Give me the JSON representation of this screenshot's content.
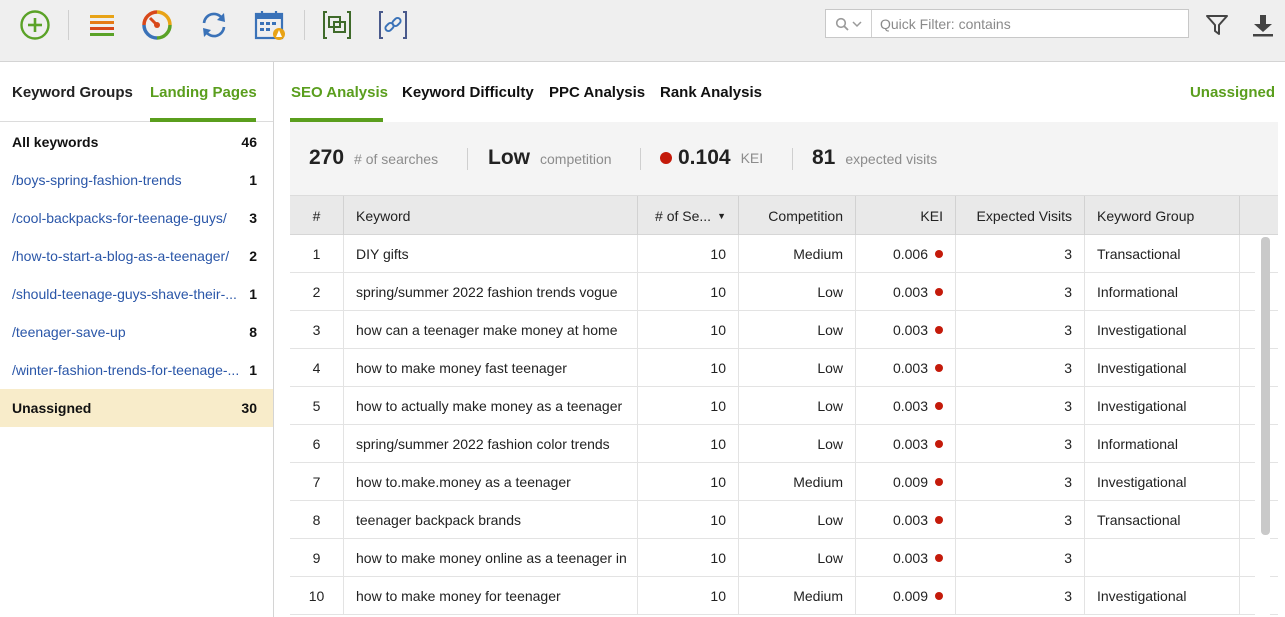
{
  "toolbar": {
    "buttons": [
      {
        "name": "add-icon"
      },
      {
        "name": "list-icon"
      },
      {
        "name": "gauge-icon"
      },
      {
        "name": "refresh-icon"
      },
      {
        "name": "calendar-schedule-icon"
      },
      {
        "name": "copy-icon"
      },
      {
        "name": "link-icon"
      }
    ],
    "quick_filter": {
      "placeholder": "Quick Filter: contains",
      "value": ""
    },
    "accent_color": "#5a9e1d"
  },
  "left_panel": {
    "tabs": [
      {
        "label": "Keyword Groups",
        "active": false
      },
      {
        "label": "Landing Pages",
        "active": true
      }
    ],
    "items": [
      {
        "label": "All keywords",
        "count": "46",
        "bold": true,
        "selected": false
      },
      {
        "label": "/boys-spring-fashion-trends",
        "count": "1",
        "bold": false,
        "selected": false
      },
      {
        "label": "/cool-backpacks-for-teenage-guys/",
        "count": "3",
        "bold": false,
        "selected": false
      },
      {
        "label": "/how-to-start-a-blog-as-a-teenager/",
        "count": "2",
        "bold": false,
        "selected": false
      },
      {
        "label": "/should-teenage-guys-shave-their-...",
        "count": "1",
        "bold": false,
        "selected": false
      },
      {
        "label": "/teenager-save-up",
        "count": "8",
        "bold": false,
        "selected": false
      },
      {
        "label": "/winter-fashion-trends-for-teenage-...",
        "count": "1",
        "bold": false,
        "selected": false
      },
      {
        "label": "Unassigned",
        "count": "30",
        "bold": true,
        "selected": true
      }
    ]
  },
  "main": {
    "tabs": [
      {
        "label": "SEO Analysis",
        "active": true
      },
      {
        "label": "Keyword Difficulty",
        "active": false
      },
      {
        "label": "PPC Analysis",
        "active": false
      },
      {
        "label": "Rank Analysis",
        "active": false
      }
    ],
    "current_group": "Unassigned",
    "summary": {
      "searches": {
        "value": "270",
        "label": "# of searches"
      },
      "competition": {
        "value": "Low",
        "label": "competition"
      },
      "kei": {
        "value": "0.104",
        "label": "KEI",
        "dot_color": "#c41a0a"
      },
      "visits": {
        "value": "81",
        "label": "expected visits"
      }
    },
    "table": {
      "columns": [
        "#",
        "Keyword",
        "# of Se...",
        "Competition",
        "KEI",
        "Expected Visits",
        "Keyword Group"
      ],
      "sorted_column": "# of Se...",
      "rows": [
        {
          "num": "1",
          "keyword": "DIY gifts",
          "searches": "10",
          "competition": "Medium",
          "kei": "0.006",
          "visits": "3",
          "group": "Transactional"
        },
        {
          "num": "2",
          "keyword": "spring/summer 2022 fashion trends vogue",
          "searches": "10",
          "competition": "Low",
          "kei": "0.003",
          "visits": "3",
          "group": "Informational"
        },
        {
          "num": "3",
          "keyword": "how can a teenager make money at home",
          "searches": "10",
          "competition": "Low",
          "kei": "0.003",
          "visits": "3",
          "group": "Investigational"
        },
        {
          "num": "4",
          "keyword": "how to make money fast teenager",
          "searches": "10",
          "competition": "Low",
          "kei": "0.003",
          "visits": "3",
          "group": "Investigational"
        },
        {
          "num": "5",
          "keyword": "how to actually make money as a teenager",
          "searches": "10",
          "competition": "Low",
          "kei": "0.003",
          "visits": "3",
          "group": "Investigational"
        },
        {
          "num": "6",
          "keyword": "spring/summer 2022 fashion color trends",
          "searches": "10",
          "competition": "Low",
          "kei": "0.003",
          "visits": "3",
          "group": "Informational"
        },
        {
          "num": "7",
          "keyword": "how to.make.money as a teenager",
          "searches": "10",
          "competition": "Medium",
          "kei": "0.009",
          "visits": "3",
          "group": "Investigational"
        },
        {
          "num": "8",
          "keyword": "teenager backpack brands",
          "searches": "10",
          "competition": "Low",
          "kei": "0.003",
          "visits": "3",
          "group": "Transactional"
        },
        {
          "num": "9",
          "keyword": "how to make money online as a teenager in",
          "searches": "10",
          "competition": "Low",
          "kei": "0.003",
          "visits": "3",
          "group": ""
        },
        {
          "num": "10",
          "keyword": "how to make money for teenager",
          "searches": "10",
          "competition": "Medium",
          "kei": "0.009",
          "visits": "3",
          "group": "Investigational"
        }
      ]
    }
  }
}
